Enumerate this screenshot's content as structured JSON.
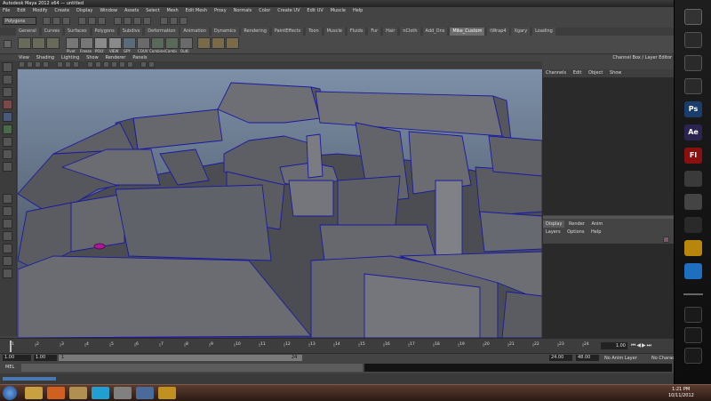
{
  "window": {
    "title": "Autodesk Maya 2012 x64 — untitled"
  },
  "menu": [
    "File",
    "Edit",
    "Modify",
    "Create",
    "Display",
    "Window",
    "Assets",
    "Select",
    "Mesh",
    "Edit Mesh",
    "Proxy",
    "Normals",
    "Color",
    "Create UV",
    "Edit UV",
    "Muscle",
    "Help"
  ],
  "status": {
    "mode": "Polygons"
  },
  "shelf_tabs": [
    "General",
    "Curves",
    "Surfaces",
    "Polygons",
    "Subdivs",
    "Deformation",
    "Animation",
    "Dynamics",
    "Rendering",
    "PaintEffects",
    "Toon",
    "Muscle",
    "Fluids",
    "Fur",
    "Hair",
    "nCloth",
    "Add_Ons",
    "Mike_Custom",
    "tWrap4",
    "Xgary",
    "Loading"
  ],
  "active_shelf": "Mike_Custom",
  "shelf_labels": [
    "Pivot",
    "Freeze",
    "POLY",
    "VIEW",
    "GPY",
    "COUV",
    "Combine",
    "Combi",
    "Outli"
  ],
  "panel_menu": [
    "View",
    "Shading",
    "Lighting",
    "Show",
    "Renderer",
    "Panels"
  ],
  "channel_box": {
    "title": "Channel Box / Layer Editor",
    "menu": [
      "Channels",
      "Edit",
      "Object",
      "Show"
    ]
  },
  "layer_editor": {
    "tabs": [
      "Display",
      "Render",
      "Anim"
    ],
    "menu": [
      "Layers",
      "Options",
      "Help"
    ]
  },
  "timeline": {
    "ticks": [
      "1",
      "2",
      "3",
      "4",
      "5",
      "6",
      "7",
      "8",
      "9",
      "10",
      "11",
      "12",
      "13",
      "14",
      "15",
      "16",
      "17",
      "18",
      "19",
      "20",
      "21",
      "22",
      "23",
      "24"
    ],
    "current_frame": "1.00"
  },
  "range": {
    "start": "1.00",
    "inner_start": "1.00",
    "handle": "1",
    "handle_end": "24",
    "end": "24.00",
    "anim_end": "48.00",
    "anim_layer": "No Anim Layer",
    "char_set": "No Charac"
  },
  "cmdline": {
    "label": "MEL"
  },
  "taskbar": {
    "time": "1:21 PM",
    "date": "10/11/2012"
  },
  "dock": [
    {
      "name": "photoshop-icon",
      "label": "Ps",
      "color": "#1b3d6b"
    },
    {
      "name": "aftereffects-icon",
      "label": "Ae",
      "color": "#2b2450"
    },
    {
      "name": "flash-icon",
      "label": "Fl",
      "color": "#8a1010"
    }
  ]
}
